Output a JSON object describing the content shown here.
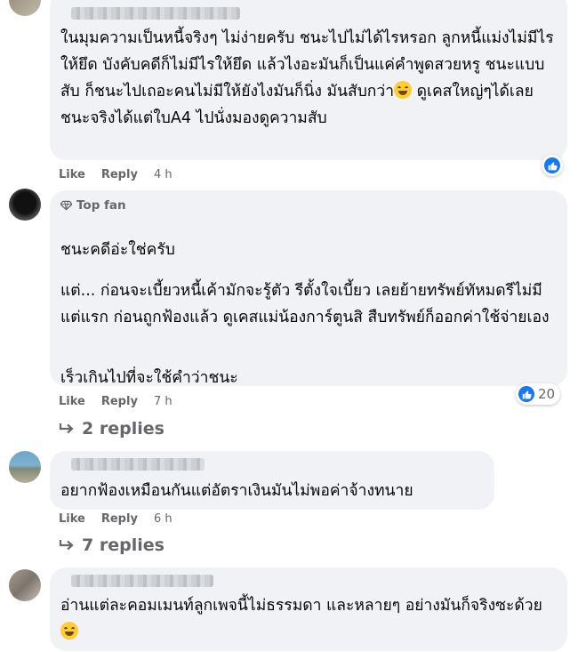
{
  "comments": [
    {
      "text": "ในมุมความเป็นหนี้จริงๆ ไม่ง่ายครับ ชนะไปไม่ได้ไรหรอก ลูกหนี้แม่งไม่มีไรให้ยึด บังคับคดีก็ไม่มีไรให้ยึด แล้วไงอะมันก็เป็นแค่คำพูดสวยหรู ชนะแบบสับ ก็ชนะไปเถอะคนไม่มีให้ยังไงมันก็นิ่ง มันสับกว่า",
      "text_end": " ดูเคสใหญ่ๆได้เลยชนะจริงได้แต่ใบA4 ไปนั่งมองดูความสับ",
      "like": "Like",
      "reply": "Reply",
      "time": "4 h"
    },
    {
      "badge": "Top fan",
      "paragraphs": [
        "ชนะคดีอ่ะใช่ครับ",
        "แต่... ก่อนจะเบี้ยวหนี้เค้ามักจะรู้ตัว รีตั้งใจเบี้ยว เลยย้ายทรัพย์ทัหมดรีไม่มีแต่แรก ก่อนถูกฟ้องแล้ว ดูเคสแม่น้องการ์ตูนสิ สืบทรัพย์ก็ออกค่าใช้จ่ายเอง",
        "เร็วเกินไปที่จะใช้คำว่าชนะ"
      ],
      "like": "Like",
      "reply": "Reply",
      "time": "7 h",
      "reaction_count": "20",
      "replies": "2 replies"
    },
    {
      "text": "อยากฟ้องเหมือนกันแต่อัตราเงินมันไม่พอค่าจ้างทนาย",
      "like": "Like",
      "reply": "Reply",
      "time": "6 h",
      "replies": "7 replies"
    },
    {
      "text": "อ่านแต่ละคอมเมนท์ลูกเพจนี้ไม่ธรรมดา และหลายๆ อย่างมันก็จริงซะด้วย"
    }
  ],
  "icons": {
    "like": "like-thumb-icon",
    "reply_arrow": "reply-arrow-icon",
    "diamond": "diamond-icon",
    "laugh_emoji": "laughing-emoji",
    "smile_emoji": "smiling-emoji"
  },
  "colors": {
    "bubble": "#f0f2f5",
    "like_blue": "#1877f2",
    "meta_gray": "#65676b"
  }
}
